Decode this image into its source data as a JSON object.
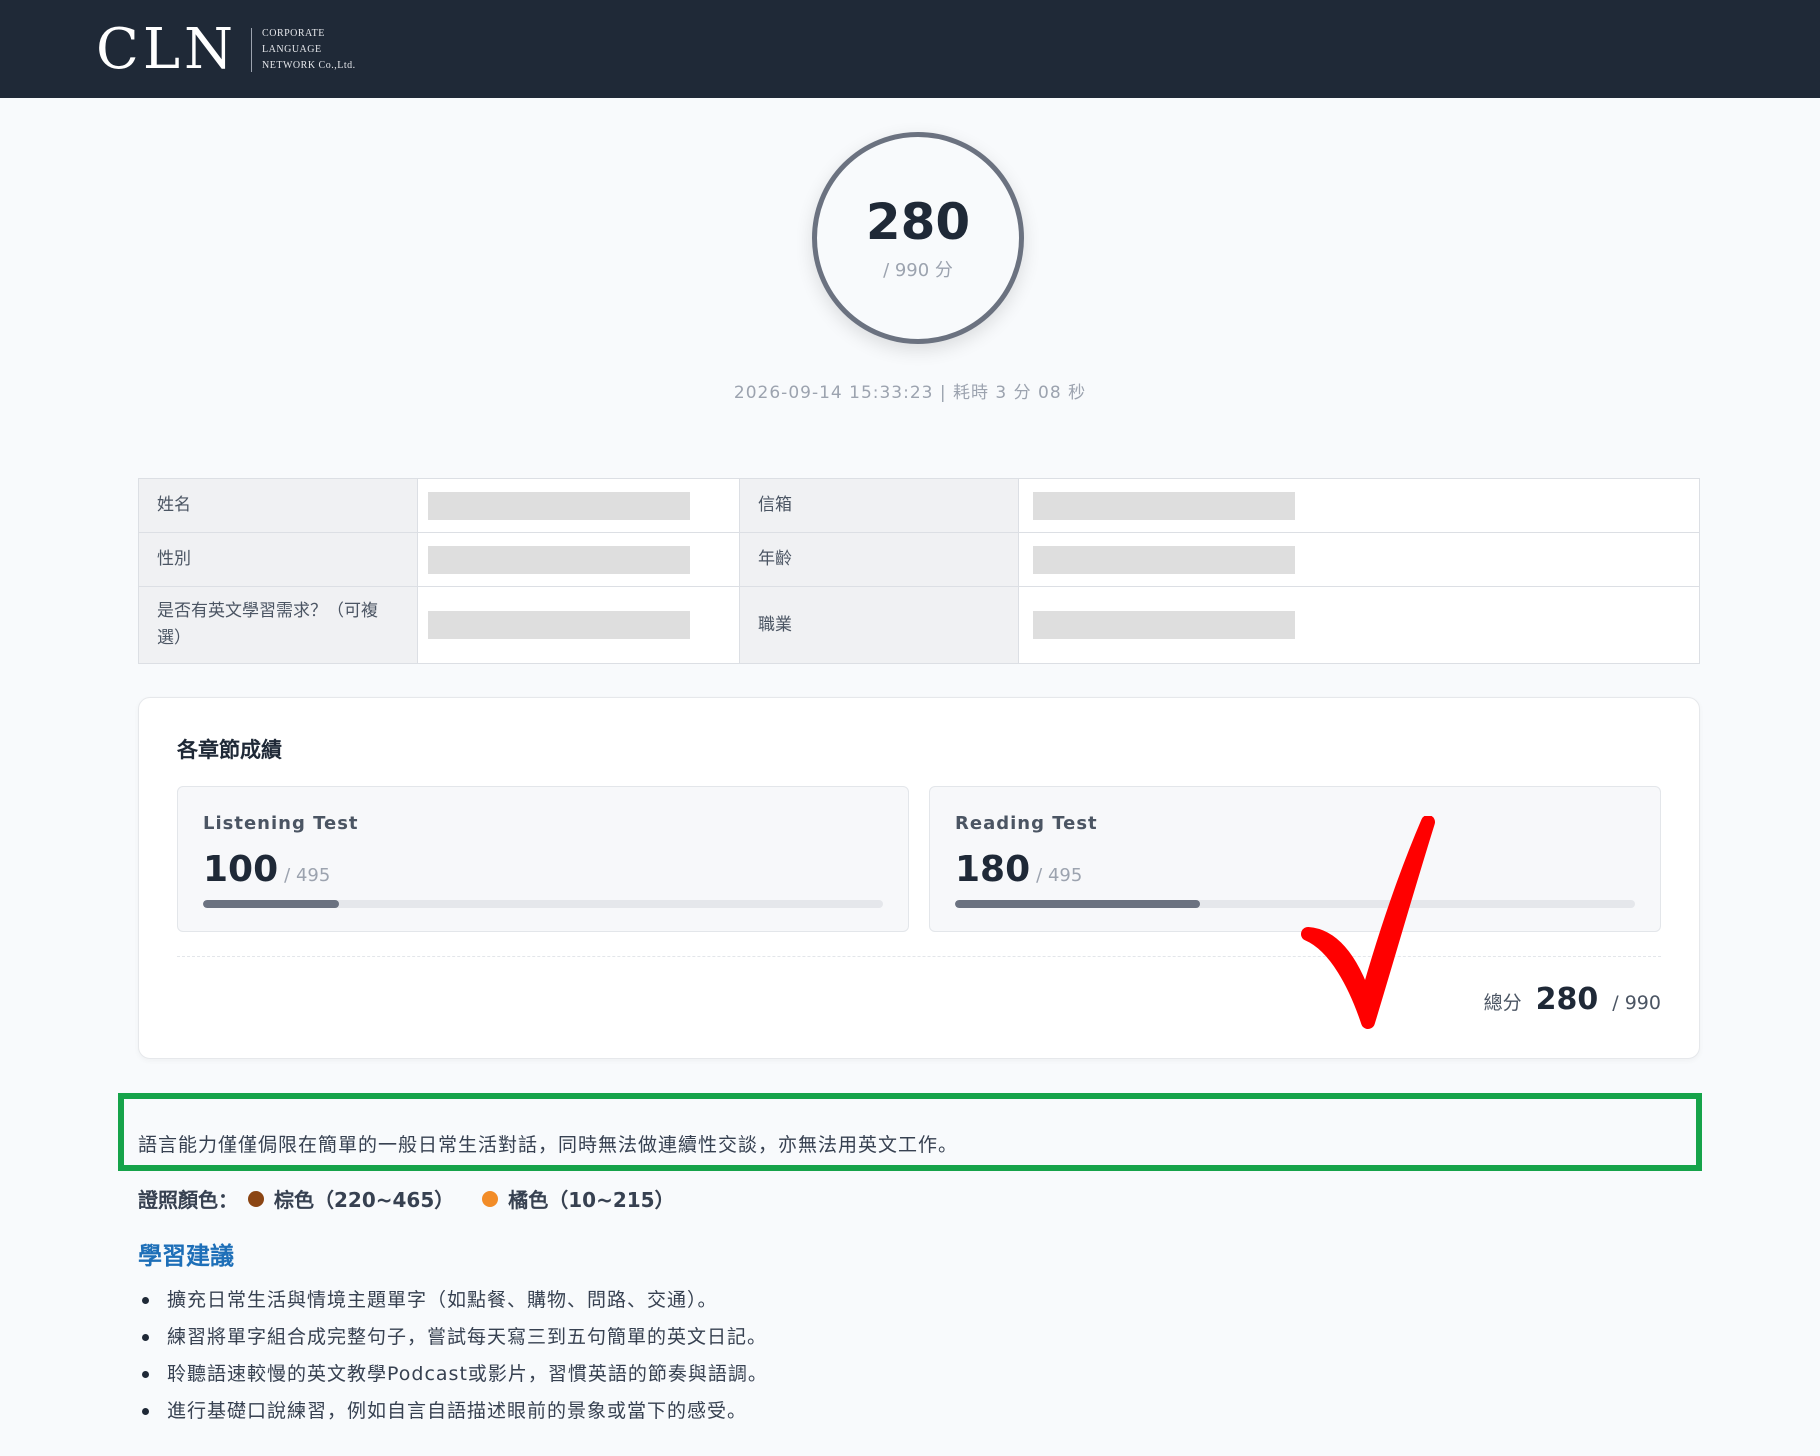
{
  "header": {
    "logo_mark": "CLN",
    "logo_lines": [
      "CORPORATE",
      "LANGUAGE",
      "NETWORK Co.,Ltd."
    ]
  },
  "score": {
    "total": "280",
    "max_label": "/ 990 分",
    "meta": "2026-09-14 15:33:23 | 耗時 3 分 08 秒"
  },
  "profile": {
    "name_label": "姓名",
    "email_label": "信箱",
    "gender_label": "性別",
    "age_label": "年齡",
    "need_label": "是否有英文學習需求？（可複選）",
    "job_label": "職業"
  },
  "sections": {
    "title": "各章節成績",
    "listening": {
      "name": "Listening Test",
      "score": "100",
      "max": "/ 495",
      "fraction": 0.2
    },
    "reading": {
      "name": "Reading Test",
      "score": "180",
      "max": "/ 495",
      "fraction": 0.36
    },
    "total_label": "總分",
    "total_value": "280",
    "total_max": "/ 990"
  },
  "result": {
    "description": "語言能力僅僅侷限在簡單的一般日常生活對話，同時無法做連續性交談，亦無法用英文工作。",
    "cert_label": "證照顏色：",
    "cert_items": [
      {
        "label": "棕色（220~465）",
        "color": "#8b4513"
      },
      {
        "label": "橘色（10~215）",
        "color": "#f28c28"
      }
    ]
  },
  "tips": {
    "title": "學習建議",
    "items": [
      "擴充日常生活與情境主題單字（如點餐、購物、問路、交通）。",
      "練習將單字組合成完整句子，嘗試每天寫三到五句簡單的英文日記。",
      "聆聽語速較慢的英文教學Podcast或影片，習慣英語的節奏與語調。",
      "進行基礎口說練習，例如自言自語描述眼前的景象或當下的感受。"
    ]
  },
  "colors": {
    "header_bg": "#1f2937",
    "highlight_border": "#16a34a",
    "annotation_arrow": "#ff0000",
    "tips_title": "#1e6fb8"
  }
}
